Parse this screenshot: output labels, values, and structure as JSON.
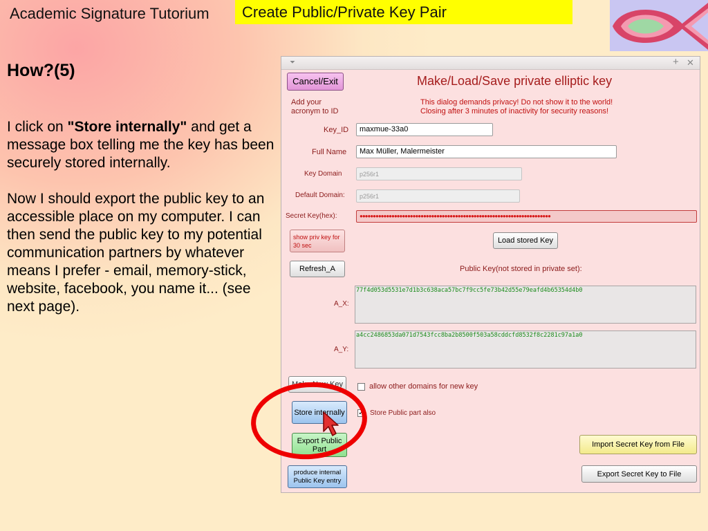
{
  "slide": {
    "tutorium_title": "Academic Signature Tutorium",
    "banner_title": "Create Public/Private Key Pair",
    "heading": "How?(5)",
    "para1_pre": "I click on ",
    "para1_bold": "\"Store internally\"",
    "para1_post": " and get a message box telling me the key has been securely stored internally.",
    "para2": "Now I should export the public key to an accessible place on my computer. I can then send the public key to my potential communication partners by whatever means I prefer - email, memory-stick, website, facebook, you name it...  (see next page)."
  },
  "dialog": {
    "titlebar": {
      "menu_glyph": "⏷",
      "maximize_glyph": "+",
      "close_glyph": "✕"
    },
    "cancel_label": "Cancel/Exit",
    "title": "Make/Load/Save private elliptic key",
    "add_acronym_label": "Add your acronym to ID",
    "privacy_notice_line1": "This dialog demands privacy! Do not show it to the world!",
    "privacy_notice_line2": "Closing after 3 minutes of inactivity for security reasons!",
    "key_id_label": "Key_ID",
    "key_id_value": "maxmue-33a0",
    "full_name_label": "Full Name",
    "full_name_value": "Max Müller, Malermeister",
    "key_domain_label": "Key Domain",
    "key_domain_value": "p256r1",
    "default_domain_label": "Default Domain:",
    "default_domain_value": "p256r1",
    "secret_key_label": "Secret Key(hex):",
    "secret_key_masked": "●●●●●●●●●●●●●●●●●●●●●●●●●●●●●●●●●●●●●●●●●●●●●●●●●●●●●●●●●●●●●●●●●●●●●●●●",
    "show_priv_key_label": "show priv key for 30 sec",
    "load_stored_key_label": "Load stored Key",
    "refresh_label": "Refresh_A",
    "public_key_label": "Public Key(not stored in private set):",
    "a_x_label": "A_X:",
    "a_x_value": "77f4d053d5531e7d1b3c638aca57bc7f9cc5fe73b42d55e79eafd4b65354d4b0",
    "a_y_label": "A_Y:",
    "a_y_value": "a4cc2486853da071d7543fcc8ba2b8500f503a58cddcfd8532f8c2281c97a1a0",
    "make_new_key_label": "Make New Key",
    "allow_domains_label": "allow other domains for new key",
    "allow_domains_checked": false,
    "store_internally_label": "Store internally",
    "store_public_label": "Store Public part also",
    "store_public_checked": true,
    "export_public_label": "Export Public Part",
    "import_secret_label": "Import Secret Key from File",
    "produce_internal_label": "produce internal Public Key entry",
    "export_secret_label": "Export Secret Key to File"
  }
}
